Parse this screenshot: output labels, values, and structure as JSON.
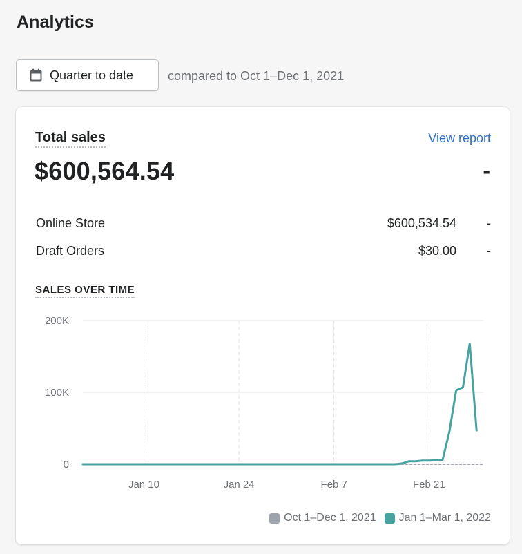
{
  "page": {
    "title": "Analytics"
  },
  "date_filter": {
    "label": "Quarter to date",
    "icon": "calendar-icon",
    "comparison_text": "compared to Oct 1–Dec 1, 2021"
  },
  "card": {
    "title": "Total sales",
    "view_report_label": "View report",
    "total_value": "$600,564.54",
    "total_change": "-",
    "breakdown": [
      {
        "name": "Online Store",
        "value": "$600,534.54",
        "change": "-"
      },
      {
        "name": "Draft Orders",
        "value": "$30.00",
        "change": "-"
      }
    ],
    "section_title": "SALES OVER TIME"
  },
  "colors": {
    "current_series": "#47a3a0",
    "previous_series": "#9ea3ab",
    "link": "#2c6ecb"
  },
  "chart_data": {
    "type": "line",
    "title": "",
    "xlabel": "",
    "ylabel": "",
    "ylim": [
      0,
      200000
    ],
    "y_ticks": [
      {
        "value": 0,
        "label": "0"
      },
      {
        "value": 100000,
        "label": "100K"
      },
      {
        "value": 200000,
        "label": "200K"
      }
    ],
    "x_ticks": [
      {
        "day": 10,
        "label": "Jan 10"
      },
      {
        "day": 24,
        "label": "Jan 24"
      },
      {
        "day": 38,
        "label": "Feb 7"
      },
      {
        "day": 52,
        "label": "Feb 21"
      }
    ],
    "x_domain": [
      1,
      60
    ],
    "grid": true,
    "legend_position": "bottom-right",
    "series": [
      {
        "name": "Oct 1–Dec 1, 2021",
        "color": "#9ea3ab",
        "style": "dotted",
        "x": [
          1,
          60
        ],
        "values": [
          0,
          0
        ]
      },
      {
        "name": "Jan 1–Mar 1, 2022",
        "color": "#47a3a0",
        "style": "solid",
        "x": [
          1,
          5,
          10,
          15,
          20,
          25,
          30,
          35,
          40,
          45,
          47,
          48,
          49,
          50,
          51,
          52,
          53,
          54,
          55,
          56,
          57,
          58,
          59
        ],
        "values": [
          0,
          0,
          0,
          0,
          0,
          0,
          0,
          0,
          0,
          0,
          0,
          1000,
          4000,
          4000,
          5000,
          5000,
          5500,
          6000,
          45000,
          103000,
          107000,
          168000,
          47000
        ]
      }
    ]
  }
}
